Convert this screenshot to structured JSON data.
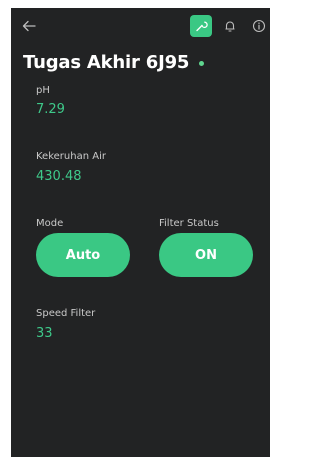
{
  "header": {
    "back_icon": "arrow-left-icon",
    "wrench_icon": "wrench-icon",
    "bell_icon": "bell-icon",
    "info_icon": "info-icon",
    "title": "Tugas Akhir 6J95"
  },
  "fields": {
    "ph_label": "pH",
    "ph_value": "7.29",
    "turbidity_label": "Kekeruhan Air",
    "turbidity_value": "430.48",
    "mode_label": "Mode",
    "mode_button": "Auto",
    "filter_status_label": "Filter Status",
    "filter_status_button": "ON",
    "speed_label": "Speed Filter",
    "speed_value": "33"
  },
  "colors": {
    "background": "#222324",
    "accent_green": "#3ac884",
    "value_green": "#3ec98a",
    "online_dot": "#5fd68f",
    "button_green": "#3ac884",
    "label_gray": "#c9c9c9"
  }
}
